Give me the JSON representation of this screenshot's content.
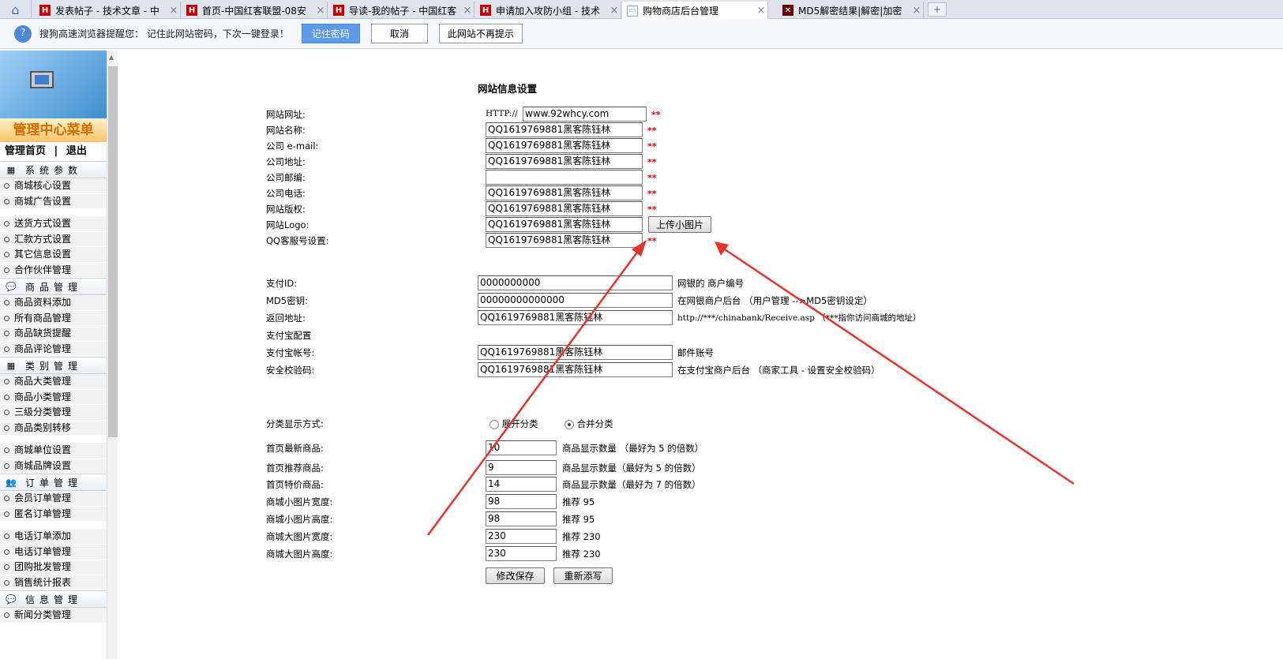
{
  "tabs": [
    {
      "label": "发表帖子 - 技术文章 - 中",
      "icon": "h-icon"
    },
    {
      "label": "首页-中国红客联盟-08安",
      "icon": "h-icon"
    },
    {
      "label": "导读-我的帖子 - 中国红客",
      "icon": "h-icon"
    },
    {
      "label": "申请加入攻防小组 - 技术",
      "icon": "h-icon"
    },
    {
      "label": "购物商店后台管理",
      "icon": "doc-icon"
    },
    {
      "label": "MD5解密结果|解密|加密",
      "icon": "md5-icon"
    }
  ],
  "notify": {
    "text": "搜狗高速浏览器提醒您： 记住此网站密码，下次一键登录！",
    "remember": "记住密码",
    "cancel": "取消",
    "never": "此网站不再提示"
  },
  "sidebar": {
    "title": "管理中心菜单",
    "home": "管理首页",
    "sep": "|",
    "logout": "退出",
    "sec1": "系统参数",
    "sec1_items": [
      "商城核心设置",
      "商城广告设置",
      "送货方式设置",
      "汇款方式设置",
      "其它信息设置",
      "合作伙伴管理"
    ],
    "sec2": "商品管理",
    "sec2_items": [
      "商品资料添加",
      "所有商品管理",
      "商品缺货提醒",
      "商品评论管理"
    ],
    "sec3": "类别管理",
    "sec3_items": [
      "商品大类管理",
      "商品小类管理",
      "三级分类管理",
      "商品类别转移",
      "商城单位设置",
      "商城品牌设置"
    ],
    "sec4": "订单管理",
    "sec4_items": [
      "会员订单管理",
      "匿名订单管理",
      "电话订单添加",
      "电话订单管理",
      "团购批发管理",
      "销售统计报表"
    ],
    "sec5": "信息管理",
    "sec5_items": [
      "新闻分类管理"
    ]
  },
  "form": {
    "title": "网站信息设置",
    "http": "HTTP://",
    "star": "**",
    "site_url_label": "网站网址:",
    "site_url": "www.92whcy.com",
    "site_name_label": "网站名称:",
    "email_label": "公司 e-mail:",
    "address_label": "公司地址:",
    "zip_label": "公司邮编:",
    "phone_label": "公司电话:",
    "copyright_label": "网站版权:",
    "logo_label": "网站Logo:",
    "qq_label": "QQ客服号设置:",
    "value": "QQ1619769881黑客陈钰林",
    "zip_value": "",
    "upload": "上传小图片",
    "pay_id_label": "支付ID:",
    "pay_id": "0000000000",
    "pay_id_note": "网银的 商户编号",
    "md5_label": "MD5密钥:",
    "md5": "00000000000000",
    "md5_note": "在网银商户后台 （用户管理 -->MD5密钥设定）",
    "return_label": "返回地址:",
    "return_note": "http://***/chinabank/Receive.asp （***指你访问商城的地址）",
    "alipay_config": "支付宝配置",
    "alipay_acct_label": "支付宝帐号:",
    "alipay_acct_note": "邮件账号",
    "alipay_key_label": "安全校验码:",
    "alipay_key_note": "在支付宝商户后台 （商家工具 - 设置安全校验码）",
    "cat_label": "分类显示方式:",
    "cat_expand": "展开分类",
    "cat_merge": "合并分类",
    "new_label": "首页最新商品:",
    "new_val": "10",
    "new_note": "商品显示数量 （最好为 5 的倍数）",
    "rec_label": "首页推荐商品:",
    "rec_val": "9",
    "rec_note": "商品显示数量（最好为 5 的倍数）",
    "sp_label": "首页特价商品:",
    "sp_val": "14",
    "sp_note": "商品显示数量（最好为 7 的倍数）",
    "sw_label": "商城小图片宽度:",
    "sw_val": "98",
    "sw_note": "推荐 95",
    "sh_label": "商城小图片高度:",
    "sh_val": "98",
    "sh_note": "推荐 95",
    "bw_label": "商城大图片宽度:",
    "bw_val": "230",
    "bw_note": "推荐 230",
    "bh_label": "商城大图片高度:",
    "bh_val": "230",
    "bh_note": "推荐 230",
    "save": "修改保存",
    "reset": "重新添写"
  },
  "colors": {
    "arrow": "#e8332a",
    "accent": "#5b9be8",
    "required": "#e00000"
  }
}
